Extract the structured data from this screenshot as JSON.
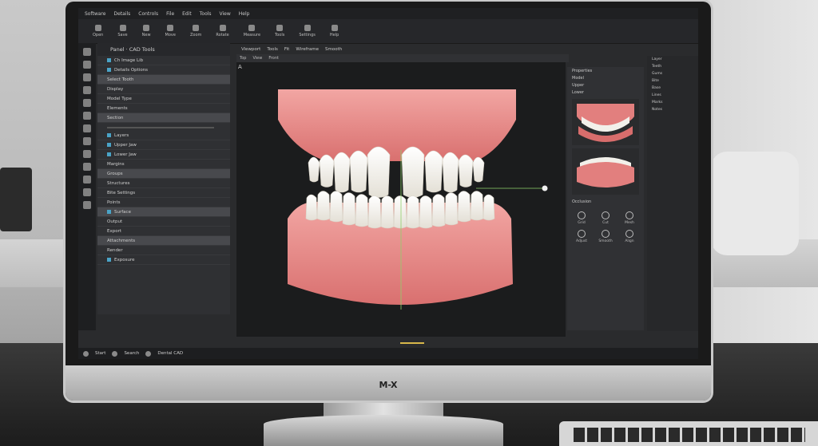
{
  "monitor": {
    "brand": "M-X"
  },
  "menubar": {
    "items": [
      "Software",
      "Details",
      "Controls",
      "File",
      "Edit",
      "Tools",
      "View",
      "Help"
    ]
  },
  "toolbar": {
    "items": [
      "Open",
      "Save",
      "New",
      "Move",
      "Zoom",
      "Rotate",
      "Measure",
      "Tools",
      "Settings",
      "Help"
    ]
  },
  "left_panel": {
    "title": "Panel · CAD Tools",
    "rows": [
      "Ch Image Lib",
      "Details Options",
      "Select Tooth",
      "Display",
      "Model Type",
      "Elements",
      "Section",
      "Layers",
      "Upper Jaw",
      "Lower Jaw",
      "Margins",
      "Groups",
      "Structures",
      "Bite Settings",
      "Points",
      "Surface",
      "Output",
      "Export",
      "Attachments",
      "Render",
      "Exposure"
    ],
    "highlighted_index": 2
  },
  "viewport": {
    "tabs": [
      "Viewport",
      "Tools",
      "Fit",
      "Wireframe",
      "Smooth"
    ],
    "sub": [
      "Top",
      "View",
      "Front"
    ],
    "corner_label": "A"
  },
  "right_panel": {
    "rows": [
      "Properties",
      "Model",
      "Upper",
      "Lower",
      "Occlusion"
    ],
    "tools": [
      "Grid",
      "Cut",
      "Mesh",
      "Adjust",
      "Smooth",
      "Align"
    ]
  },
  "right_panel2": {
    "rows": [
      "Layer",
      "Teeth",
      "Gums",
      "Bite",
      "Base",
      "Lines",
      "Marks",
      "Notes"
    ]
  },
  "taskbar": {
    "items": [
      "Start",
      "Search",
      "Dental CAD"
    ]
  },
  "colors": {
    "gum": "#e58a88",
    "tooth": "#f4f3ef",
    "ui_bg": "#2a2b2d",
    "accent": "#4aa3c7"
  }
}
